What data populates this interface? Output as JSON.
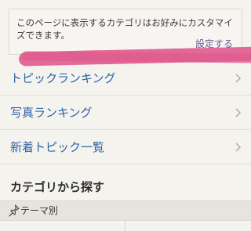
{
  "notice": {
    "text": "このページに表示するカテゴリはお好みにカスタマイズできます。",
    "link": "設定する"
  },
  "menu": {
    "items": [
      {
        "label": "トピックランキング"
      },
      {
        "label": "写真ランキング"
      },
      {
        "label": "新着トピック一覧"
      }
    ]
  },
  "section": {
    "title": "カテゴリから探す"
  },
  "theme": {
    "label": "テーマ別",
    "icon": "pin-icon"
  },
  "colors": {
    "link": "#2d66a8",
    "accent_link": "#6a5b93",
    "redaction": "#e05d90",
    "background": "#f5f3ee"
  }
}
